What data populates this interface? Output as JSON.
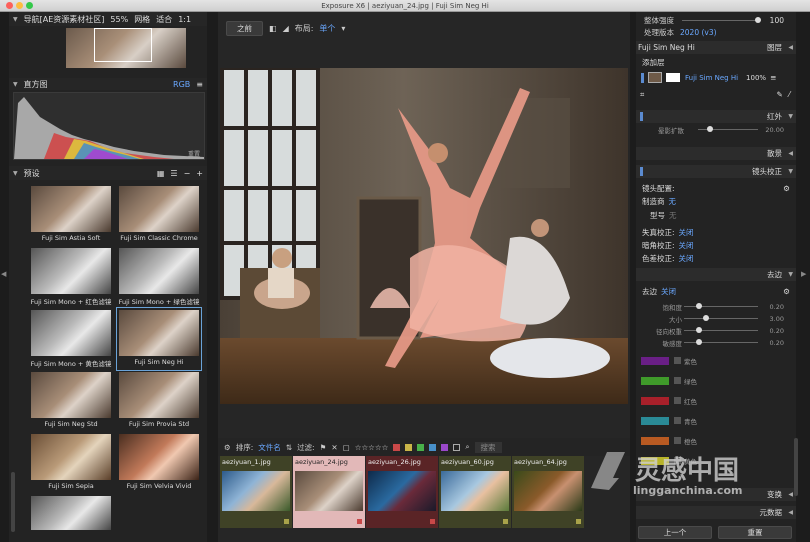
{
  "window": {
    "title": "Exposure X6 | aeziyuan_24.jpg | Fuji Sim Neg Hi"
  },
  "navigator": {
    "label": "导航[AE资源素材社区]",
    "zoom": "55%",
    "grid": "网格",
    "fit": "适合",
    "ratio": "1:1"
  },
  "histogram": {
    "label": "直方图",
    "mode": "RGB",
    "reset": "重置"
  },
  "presets": {
    "label": "预设",
    "items": [
      {
        "label": "Fuji Sim Astia Soft",
        "tone": "color"
      },
      {
        "label": "Fuji Sim Classic Chrome",
        "tone": "color"
      },
      {
        "label": "Fuji Sim Mono + 红色滤镜",
        "tone": "mono"
      },
      {
        "label": "Fuji Sim Mono + 绿色滤镜",
        "tone": "mono"
      },
      {
        "label": "Fuji Sim Mono + 黄色滤镜",
        "tone": "mono"
      },
      {
        "label": "Fuji Sim Neg Hi",
        "tone": "color"
      },
      {
        "label": "Fuji Sim Neg Std",
        "tone": "color"
      },
      {
        "label": "Fuji Sim Provia Std",
        "tone": "color"
      },
      {
        "label": "Fuji Sim Sepia",
        "tone": "sepia"
      },
      {
        "label": "Fuji Sim Velvia Vivid",
        "tone": "vivid"
      }
    ]
  },
  "toolbar": {
    "before_label": "之前",
    "layout_label": "布局:",
    "layout_value": "单个"
  },
  "filmstrip_bar": {
    "sort_label": "排序:",
    "sort_value": "文件名",
    "filter_label": "过滤:",
    "stars": "☆☆☆☆☆",
    "search_hint": "搜索"
  },
  "filmstrip": [
    {
      "name": "aeziyuan_1.jpg",
      "bg": "#3f4226"
    },
    {
      "name": "aeziyuan_24.jpg",
      "bg": "#e2b8b8"
    },
    {
      "name": "aeziyuan_26.jpg",
      "bg": "#5a2426"
    },
    {
      "name": "aeziyuan_60.jpg",
      "bg": "#3f4226"
    },
    {
      "name": "aeziyuan_64.jpg",
      "bg": "#3f4226"
    }
  ],
  "right": {
    "intensity_label": "整体强度",
    "intensity_value": "100",
    "intensity_fraction": 1.0,
    "process_label": "处理版本",
    "process_value": "2020 (v3)",
    "layer_name": "Fuji Sim Neg Hi",
    "layers_label": "图层",
    "add_layer": "添加层",
    "layer_row_name": "Fuji Sim Neg Hi",
    "layer_opacity": "100%",
    "infrared": "红外",
    "shadow_spread": "晕影扩散",
    "shadow_spread_value": "20.00",
    "shadow_spread_fraction": 0.2,
    "bokeh": "散景",
    "lens": "镜头校正",
    "lens_profile": "镜头配置:",
    "maker_label": "制造商",
    "maker_value": "无",
    "model_label": "型号",
    "model_value": "无",
    "distortion_label": "失真校正:",
    "distortion_value": "关闭",
    "vignette_label": "暗角校正:",
    "vignette_value": "关闭",
    "fringe_label": "色差校正:",
    "fringe_value": "关闭",
    "edges": "去边",
    "edges_row": "去边",
    "edges_value": "关闭",
    "sliders": [
      {
        "label": "饱和度",
        "value": "0.20",
        "fraction": 0.2
      },
      {
        "label": "大小",
        "value": "3.00",
        "fraction": 0.3
      },
      {
        "label": "径向权重",
        "value": "0.20",
        "fraction": 0.2
      },
      {
        "label": "敏感度",
        "value": "0.20",
        "fraction": 0.2
      }
    ],
    "swatches": [
      {
        "label": "紫色",
        "color": "#6a1f86"
      },
      {
        "label": "绿色",
        "color": "#3f9a2a"
      },
      {
        "label": "红色",
        "color": "#a8202a"
      },
      {
        "label": "青色",
        "color": "#2a8a96"
      },
      {
        "label": "橙色",
        "color": "#b85a22"
      },
      {
        "label": "黄色",
        "color": "#b8b42a"
      }
    ],
    "transform": "变换",
    "metadata": "元数据",
    "prev": "上一个",
    "reset": "重置"
  },
  "watermark": {
    "brand": "灵感中国",
    "url": "lingganchina.com"
  }
}
